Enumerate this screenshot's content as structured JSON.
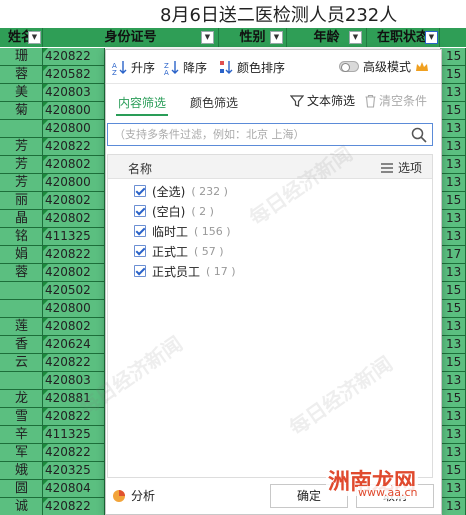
{
  "sheet": {
    "title": "8月6日送二医检测人员232人",
    "headers": {
      "name": "姓名",
      "id": "身份证号",
      "gender": "性别",
      "age": "年龄",
      "status": "在职状态"
    },
    "rows": [
      {
        "name": "珊",
        "id": "420822",
        "right": "15"
      },
      {
        "name": "蓉",
        "id": "420582",
        "right": "15"
      },
      {
        "name": "美",
        "id": "420803",
        "right": "13"
      },
      {
        "name": "菊",
        "id": "420800",
        "right": "15"
      },
      {
        "name": "",
        "id": "420800",
        "right": "13"
      },
      {
        "name": "芳",
        "id": "420822",
        "right": "13"
      },
      {
        "name": "芳",
        "id": "420802",
        "right": "13"
      },
      {
        "name": "芳",
        "id": "420800",
        "right": "13"
      },
      {
        "name": "丽",
        "id": "420802",
        "right": "15"
      },
      {
        "name": "晶",
        "id": "420802",
        "right": "13"
      },
      {
        "name": "铭",
        "id": "411325",
        "right": "13"
      },
      {
        "name": "娟",
        "id": "420822",
        "right": "17"
      },
      {
        "name": "蓉",
        "id": "420802",
        "right": "13"
      },
      {
        "name": "",
        "id": "420502",
        "right": "15"
      },
      {
        "name": "",
        "id": "420800",
        "right": "15"
      },
      {
        "name": "莲",
        "id": "420802",
        "right": "13"
      },
      {
        "name": "香",
        "id": "420624",
        "right": "13"
      },
      {
        "name": "云",
        "id": "420822",
        "right": "15"
      },
      {
        "name": "",
        "id": "420803",
        "right": "13"
      },
      {
        "name": "龙",
        "id": "420881",
        "right": "15"
      },
      {
        "name": "雪",
        "id": "420822",
        "right": "13"
      },
      {
        "name": "辛",
        "id": "411325",
        "right": "13"
      },
      {
        "name": "军",
        "id": "420822",
        "right": "13"
      },
      {
        "name": "娥",
        "id": "420325",
        "right": "15"
      },
      {
        "name": "圆",
        "id": "420804",
        "right": "13"
      },
      {
        "name": "诚",
        "id": "420822",
        "right": "13"
      }
    ]
  },
  "filter": {
    "sort_asc": "升序",
    "sort_desc": "降序",
    "sort_color": "颜色排序",
    "advanced_mode": "高级模式",
    "tab_content": "内容筛选",
    "tab_color": "颜色筛选",
    "text_filter": "文本筛选",
    "clear": "清空条件",
    "search_placeholder": "（支持多条件过滤，例如：北京 上海）",
    "list_header": "名称",
    "options": "选项",
    "items": [
      {
        "label": "(全选)",
        "count": "( 232 )",
        "checked": true
      },
      {
        "label": "(空白)",
        "count": "( 2 )",
        "checked": true
      },
      {
        "label": "临时工",
        "count": "( 156 )",
        "checked": true
      },
      {
        "label": "正式工",
        "count": "( 57 )",
        "checked": true
      },
      {
        "label": "正式员工",
        "count": "( 17 )",
        "checked": true
      }
    ],
    "analyze": "分析",
    "ok": "确定",
    "cancel": "取消"
  },
  "watermark": {
    "text": "每日经济新闻",
    "corner": "洲南龙网",
    "corner_sub": "www.aa.cn"
  },
  "colors": {
    "sheet_green": "#5bbf80",
    "header_green": "#2f9e56",
    "tab_active": "#2a9d58"
  }
}
